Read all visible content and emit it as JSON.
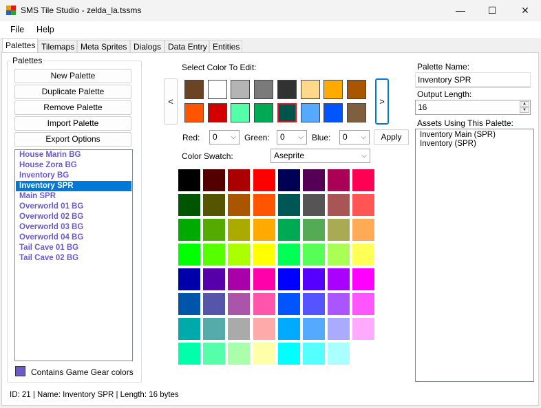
{
  "window": {
    "title": "SMS Tile Studio - zelda_la.tssms",
    "minimize": "—",
    "maximize": "☐",
    "close": "✕"
  },
  "menu": [
    "File",
    "Help"
  ],
  "tabs": [
    "Palettes",
    "Tilemaps",
    "Meta Sprites",
    "Dialogs",
    "Data Entry",
    "Entities"
  ],
  "palettes_group": {
    "title": "Palettes",
    "buttons": {
      "new": "New Palette",
      "duplicate": "Duplicate Palette",
      "remove": "Remove Palette",
      "import": "Import Palette",
      "export": "Export Options"
    },
    "items": [
      "House Marin BG",
      "House Zora BG",
      "Inventory BG",
      "Inventory SPR",
      "Main SPR",
      "Overworld 01 BG",
      "Overworld 02 BG",
      "Overworld 03 BG",
      "Overworld 04 BG",
      "Tail Cave 01 BG",
      "Tail Cave 02 BG"
    ],
    "selected_index": 3,
    "game_gear_label": "Contains Game Gear colors",
    "game_gear_color": "#6a5acd"
  },
  "editor": {
    "select_label": "Select Color To Edit:",
    "prev": "<",
    "next": ">",
    "palette_colors": [
      "#6b4423",
      "#ffffff",
      "#b4b4b4",
      "#7a7a7a",
      "#323232",
      "#ffd98a",
      "#ffaa00",
      "#aa5500",
      "#ff5500",
      "#d40000",
      "#55ffaa",
      "#00aa55",
      "#00554a",
      "#55aaff",
      "#0055ff",
      "#7f5f3f"
    ],
    "selected_color_index": 12,
    "red_label": "Red:",
    "red_value": "0",
    "green_label": "Green:",
    "green_value": "0",
    "blue_label": "Blue:",
    "blue_value": "0",
    "apply_label": "Apply",
    "swatch_label": "Color Swatch:",
    "swatch_value": "Aseprite",
    "swatch_colors": [
      "#000000",
      "#550000",
      "#aa0000",
      "#ff0000",
      "#000055",
      "#550055",
      "#aa0055",
      "#ff0055",
      "#005500",
      "#555500",
      "#aa5500",
      "#ff5500",
      "#005555",
      "#555555",
      "#aa5555",
      "#ff5555",
      "#00aa00",
      "#55aa00",
      "#aaaa00",
      "#ffaa00",
      "#00aa55",
      "#55aa55",
      "#aaaa55",
      "#ffaa55",
      "#00ff00",
      "#55ff00",
      "#aaff00",
      "#ffff00",
      "#00ff55",
      "#55ff55",
      "#aaff55",
      "#ffff55",
      "#0000aa",
      "#5500aa",
      "#aa00aa",
      "#ff00aa",
      "#0000ff",
      "#5500ff",
      "#aa00ff",
      "#ff00ff",
      "#0055aa",
      "#5555aa",
      "#aa55aa",
      "#ff55aa",
      "#0055ff",
      "#5555ff",
      "#aa55ff",
      "#ff55ff",
      "#00aaaa",
      "#55aaaa",
      "#aaaaaa",
      "#ffaaaa",
      "#00aaff",
      "#55aaff",
      "#aaaaff",
      "#ffaaff",
      "#00ffaa",
      "#55ffaa",
      "#aaffaa",
      "#ffffaa",
      "#00ffff",
      "#55ffff",
      "#aaffff",
      "#ffffff"
    ]
  },
  "properties": {
    "name_label": "Palette Name:",
    "name_value": "Inventory SPR",
    "output_label": "Output Length:",
    "output_value": "16",
    "assets_label": "Assets Using This Palette:",
    "assets": [
      "Inventory Main (SPR)",
      "Inventory (SPR)"
    ]
  },
  "status_text": "ID: 21 | Name: Inventory SPR | Length: 16 bytes"
}
